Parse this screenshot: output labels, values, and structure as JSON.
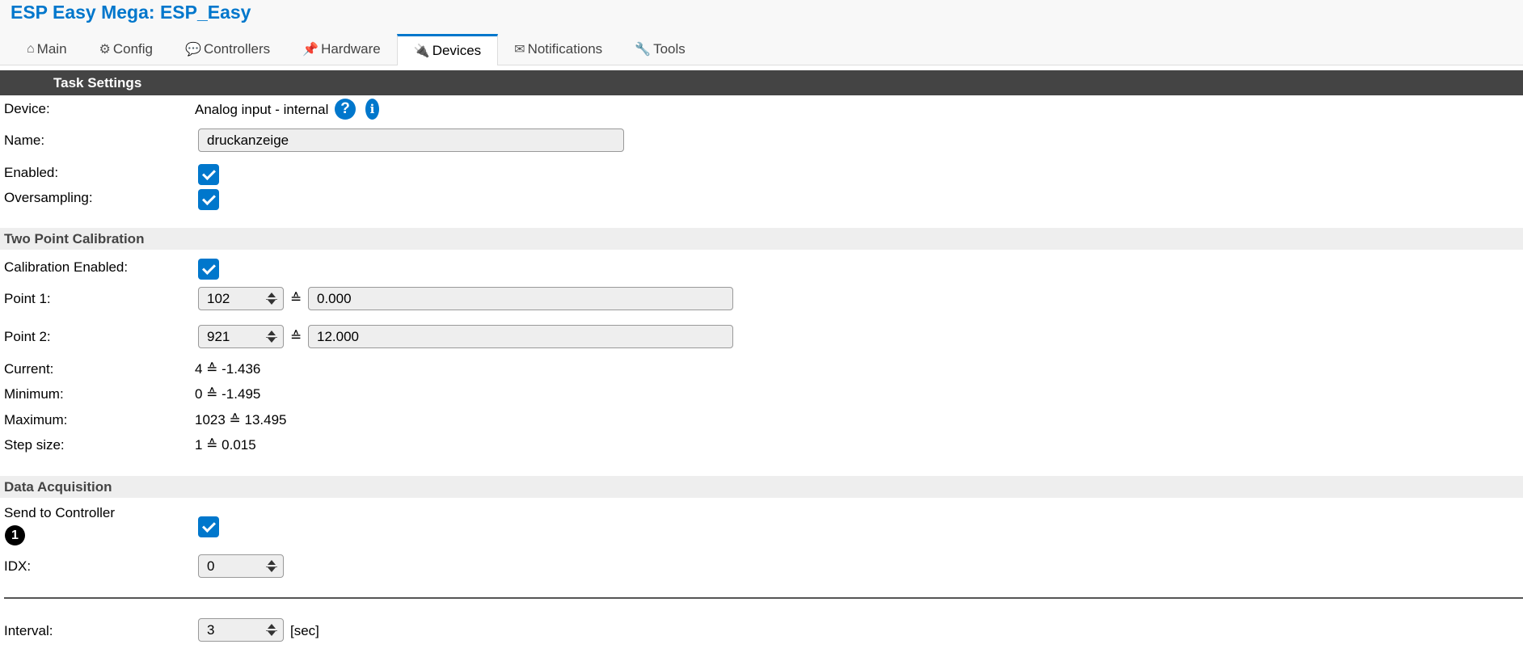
{
  "header": {
    "title": "ESP Easy Mega: ESP_Easy"
  },
  "tabs": [
    {
      "icon": "home-icon",
      "glyph": "⌂",
      "label": "Main"
    },
    {
      "icon": "config-icon",
      "glyph": "⚙",
      "label": "Config"
    },
    {
      "icon": "chat-icon",
      "glyph": "💬",
      "label": "Controllers"
    },
    {
      "icon": "pin-icon",
      "glyph": "📌",
      "label": "Hardware"
    },
    {
      "icon": "plug-icon",
      "glyph": "🔌",
      "label": "Devices",
      "active": true
    },
    {
      "icon": "envelope-icon",
      "glyph": "✉",
      "label": "Notifications"
    },
    {
      "icon": "wrench-icon",
      "glyph": "🔧",
      "label": "Tools"
    }
  ],
  "task": {
    "header": "Task Settings",
    "device_label": "Device:",
    "device_value": "Analog input - internal",
    "help_glyph": "?",
    "info_glyph": "i",
    "name_label": "Name:",
    "name_value": "druckanzeige",
    "enabled_label": "Enabled:",
    "enabled": true,
    "oversampling_label": "Oversampling:",
    "oversampling": true
  },
  "calibration": {
    "header": "Two Point Calibration",
    "enabled_label": "Calibration Enabled:",
    "enabled": true,
    "equiv_symbol": "≙",
    "point1_label": "Point 1:",
    "point1_raw": "102",
    "point1_value": "0.000",
    "point2_label": "Point 2:",
    "point2_raw": "921",
    "point2_value": "12.000",
    "current_label": "Current:",
    "current_value": "4 ≙ -1.436",
    "minimum_label": "Minimum:",
    "minimum_value": "0 ≙ -1.495",
    "maximum_label": "Maximum:",
    "maximum_value": "1023 ≙ 13.495",
    "step_label": "Step size:",
    "step_value": "1 ≙ 0.015"
  },
  "acquisition": {
    "header": "Data Acquisition",
    "send_label": "Send to Controller",
    "controller_badge": "1",
    "send": true,
    "idx_label": "IDX:",
    "idx_value": "0",
    "interval_label": "Interval:",
    "interval_value": "3",
    "interval_unit": "[sec]"
  },
  "colors": {
    "accent": "#0077cc",
    "header_bg": "#444444",
    "section_bg": "#eeeeee"
  }
}
